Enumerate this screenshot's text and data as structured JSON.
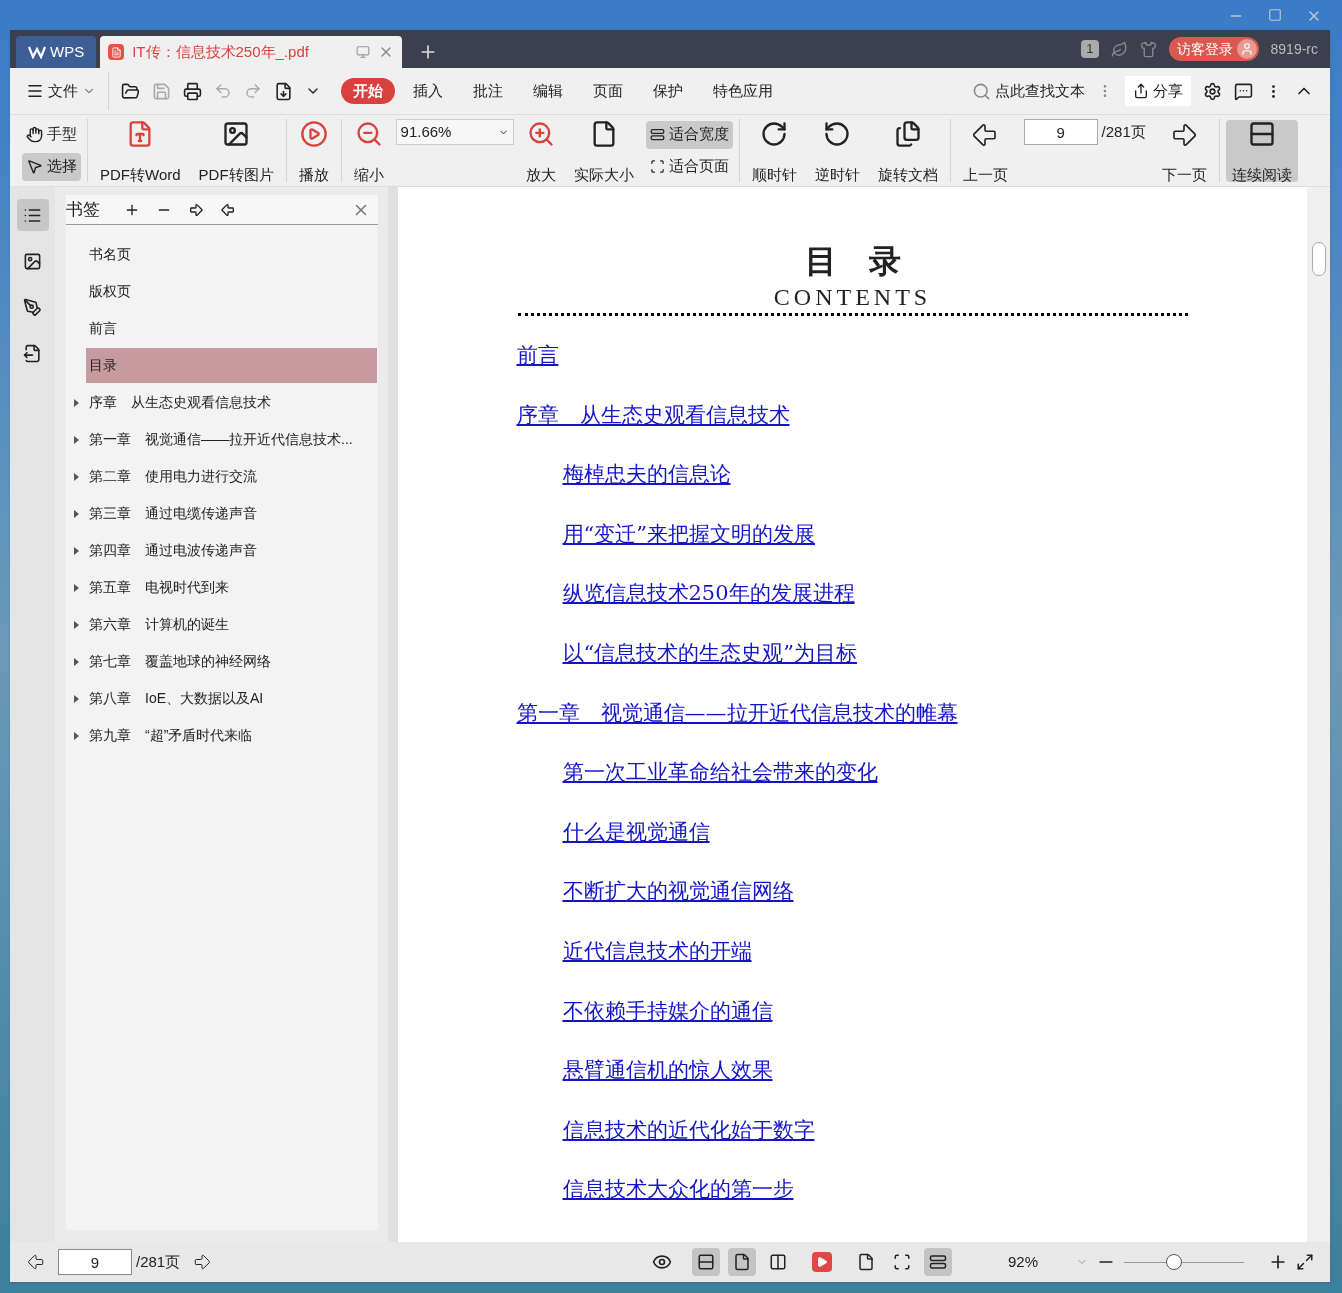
{
  "title_bar": {
    "tabs": [
      {
        "kind": "home",
        "label": "WPS",
        "selected": false
      },
      {
        "kind": "pdf",
        "label": "IT传：信息技术250年_.pdf",
        "selected": true
      }
    ],
    "window_count": "1",
    "login": "访客登录",
    "version": "8919-rc"
  },
  "menu_bar": {
    "file": "文件",
    "tabs": [
      {
        "label": "开始",
        "selected": true
      },
      {
        "label": "插入",
        "selected": false
      },
      {
        "label": "批注",
        "selected": false
      },
      {
        "label": "编辑",
        "selected": false
      },
      {
        "label": "页面",
        "selected": false
      },
      {
        "label": "保护",
        "selected": false
      },
      {
        "label": "特色应用",
        "selected": false
      }
    ],
    "search": "点此查找文本",
    "share": "分享"
  },
  "toolbar": {
    "hand": {
      "label": "手型",
      "selected": false
    },
    "select": {
      "label": "选择",
      "selected": true
    },
    "pdf_to_word": "PDF转Word",
    "pdf_to_image": "PDF转图片",
    "play": "播放",
    "zoom_out": "缩小",
    "zoom_value": "91.66%",
    "zoom_in": "放大",
    "actual_size": "实际大小",
    "fit_width": {
      "label": "适合宽度",
      "selected": true
    },
    "fit_page": {
      "label": "适合页面",
      "selected": false
    },
    "clockwise": "顺时针",
    "counterclockwise": "逆时针",
    "rotate_document": "旋转文档",
    "prev_page": "上一页",
    "page": "9",
    "page_total": "/281页",
    "next_page": "下一页",
    "continuous": {
      "label": "连续阅读",
      "selected": true
    }
  },
  "side_rail": [
    {
      "kind": "bookmarks",
      "selected": true
    },
    {
      "kind": "thumbnails",
      "selected": false
    },
    {
      "kind": "annotations",
      "selected": false
    },
    {
      "kind": "convert",
      "selected": false
    }
  ],
  "bookmarks": {
    "title": "书签",
    "items": [
      {
        "label": "书名页",
        "expandable": false,
        "selected": false
      },
      {
        "label": "版权页",
        "expandable": false,
        "selected": false
      },
      {
        "label": "前言",
        "expandable": false,
        "selected": false
      },
      {
        "label": "目录",
        "expandable": false,
        "selected": true
      },
      {
        "label": "序章　从生态史观看信息技术",
        "expandable": true,
        "selected": false
      },
      {
        "label": "第一章　视觉通信——拉开近代信息技术...",
        "expandable": true,
        "selected": false
      },
      {
        "label": "第二章　使用电力进行交流",
        "expandable": true,
        "selected": false
      },
      {
        "label": "第三章　通过电缆传递声音",
        "expandable": true,
        "selected": false
      },
      {
        "label": "第四章　通过电波传递声音",
        "expandable": true,
        "selected": false
      },
      {
        "label": "第五章　电视时代到来",
        "expandable": true,
        "selected": false
      },
      {
        "label": "第六章　计算机的诞生",
        "expandable": true,
        "selected": false
      },
      {
        "label": "第七章　覆盖地球的神经网络",
        "expandable": true,
        "selected": false
      },
      {
        "label": "第八章　IoE、大数据以及AI",
        "expandable": true,
        "selected": false
      },
      {
        "label": "第九章　“超”矛盾时代来临",
        "expandable": true,
        "selected": false
      }
    ]
  },
  "document": {
    "title": "目　录",
    "subtitle": "CONTENTS",
    "entries": [
      {
        "text": "前言"
      },
      {
        "text": "序章　从生态史观看信息技术",
        "children": [
          {
            "text": "梅棹忠夫的信息论"
          },
          {
            "text": "用“变迁”来把握文明的发展"
          },
          {
            "text": "纵览信息技术250年的发展进程"
          },
          {
            "text": "以“信息技术的生态史观”为目标"
          }
        ]
      },
      {
        "text": "第一章　视觉通信——拉开近代信息技术的帷幕",
        "children": [
          {
            "text": "第一次工业革命给社会带来的变化"
          },
          {
            "text": "什么是视觉通信"
          },
          {
            "text": "不断扩大的视觉通信网络"
          },
          {
            "text": "近代信息技术的开端"
          },
          {
            "text": "不依赖手持媒介的通信"
          },
          {
            "text": "悬臂通信机的惊人效果"
          },
          {
            "text": "信息技术的近代化始于数字"
          },
          {
            "text": "信息技术大众化的第一步"
          }
        ]
      }
    ]
  },
  "status_bar": {
    "page": "9",
    "page_total": "/281页",
    "layouts": [
      {
        "kind": "continuous",
        "selected": true
      },
      {
        "kind": "single",
        "selected": true
      },
      {
        "kind": "double",
        "selected": false
      }
    ],
    "fits": [
      {
        "kind": "actual",
        "selected": false
      },
      {
        "kind": "page",
        "selected": false
      },
      {
        "kind": "width",
        "selected": true
      }
    ],
    "zoom": "92%",
    "zoom_slider": {
      "level": 0.42
    }
  }
}
